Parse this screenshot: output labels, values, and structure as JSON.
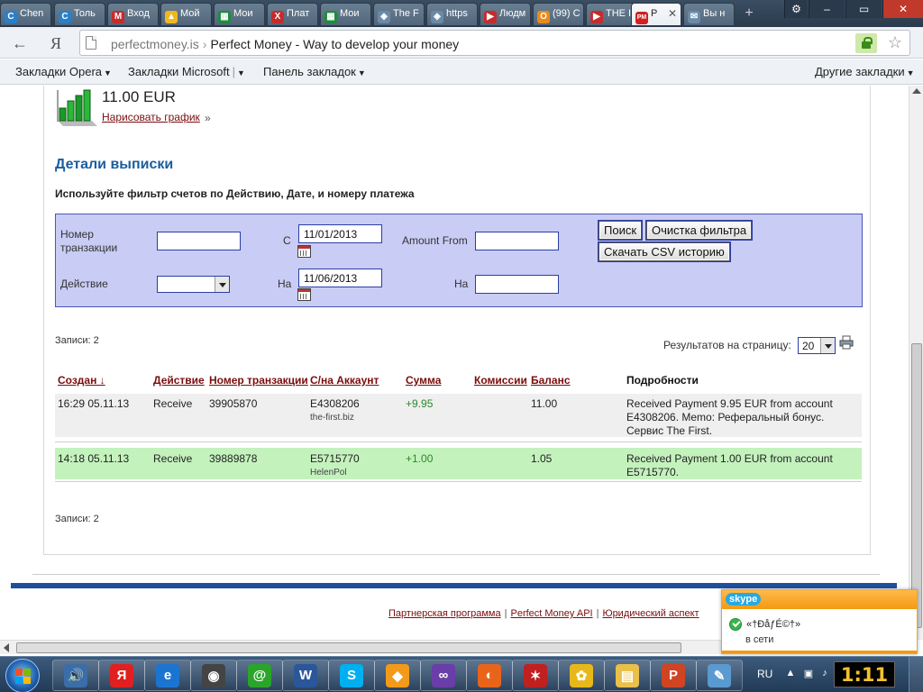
{
  "tabs": [
    {
      "label": "Chen",
      "color": "#2a7fc9",
      "glyph": "C"
    },
    {
      "label": "Толь",
      "color": "#2a7fc9",
      "glyph": "C"
    },
    {
      "label": "Вход",
      "color": "#c62b2b",
      "glyph": "M"
    },
    {
      "label": "Мой",
      "color": "#f2b61f",
      "glyph": "▲"
    },
    {
      "label": "Мои",
      "color": "#1c8d3b",
      "glyph": "▦"
    },
    {
      "label": "Плат",
      "color": "#c62b2b",
      "glyph": "X"
    },
    {
      "label": "Мои",
      "color": "#1c8d3b",
      "glyph": "▦"
    },
    {
      "label": "The F",
      "color": "#6a8aa8",
      "glyph": "◈"
    },
    {
      "label": "https",
      "color": "#6a8aa8",
      "glyph": "◈"
    },
    {
      "label": "Людм",
      "color": "#c62b2b",
      "glyph": "▶"
    },
    {
      "label": "(99) С",
      "color": "#e88a1a",
      "glyph": "О"
    },
    {
      "label": "THE I",
      "color": "#c62b2b",
      "glyph": "▶"
    },
    {
      "label": "P",
      "color": "#d42020",
      "glyph": "PM",
      "active": true
    },
    {
      "label": "Вы н",
      "color": "#6a8aa8",
      "glyph": "✉"
    }
  ],
  "address": {
    "host": "perfectmoney.is",
    "separator": "›",
    "title": "Perfect Money - Way to develop your money"
  },
  "bookmarks": {
    "opera": "Закладки Opera",
    "microsoft": "Закладки Microsoft",
    "panel": "Панель закладок",
    "other": "Другие закладки"
  },
  "balance": {
    "value": "11.00 EUR",
    "draw_chart": "Нарисовать график",
    "draw_chart_tail": "»"
  },
  "statement": {
    "title": "Детали выписки",
    "filter_hint": "Используйте фильтр счетов по Действию, Дате, и номеру платежа"
  },
  "filter": {
    "txn_label": "Номер транзакции",
    "action_label": "Действие",
    "from_label": "С",
    "to_label": "На",
    "date_from": "11/01/2013",
    "date_to": "11/06/2013",
    "amount_from_label": "Amount From",
    "amount_to_label": "На",
    "search_btn": "Поиск",
    "clear_btn": "Очистка фильтра",
    "csv_btn": "Скачать CSV историю"
  },
  "records_label": "Записи: 2",
  "per_page": {
    "label": "Результатов на страницу:",
    "value": "20"
  },
  "table": {
    "headers": {
      "created": "Создан ↓",
      "action": "Действие",
      "txn": "Номер транзакции",
      "account": "С/на Аккаунт",
      "amount": "Сумма",
      "fee": "Комиссии",
      "balance": "Баланс",
      "details": "Подробности"
    },
    "rows": [
      {
        "created": "16:29 05.11.13",
        "action": "Receive",
        "txn": "39905870",
        "account": "E4308206",
        "account_sub": "the-first.biz",
        "amount": "+9.95",
        "fee": "",
        "balance": "11.00",
        "details": "Received Payment 9.95 EUR from account E4308206. Memo: Реферальный бонус. Сервис The First."
      },
      {
        "created": "14:18 05.11.13",
        "action": "Receive",
        "txn": "39889878",
        "account": "E5715770",
        "account_sub": "HelenPol",
        "amount": "+1.00",
        "fee": "",
        "balance": "1.05",
        "details": "Received Payment 1.00 EUR from account E5715770."
      }
    ]
  },
  "footer": {
    "affiliate": "Партнерская программа",
    "api": "Perfect Money API",
    "legal": "Юридический аспект"
  },
  "skype": {
    "logo": "skype",
    "name": "«†ÐåƒÉ©†»",
    "status": "в сети"
  },
  "taskbar": {
    "lang": "RU",
    "clock": "1:11",
    "apps": [
      "volume",
      "yandex",
      "ie",
      "camera",
      "mail",
      "word",
      "skype",
      "cubes",
      "vs",
      "firefox",
      "star",
      "bee",
      "explorer",
      "powerpoint",
      "paint"
    ]
  }
}
